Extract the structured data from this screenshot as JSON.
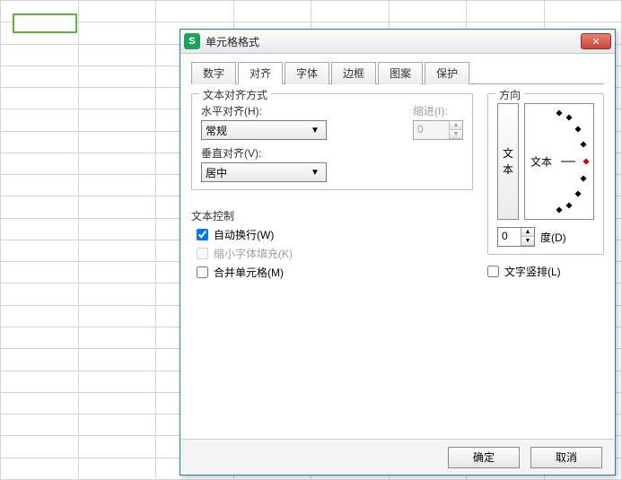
{
  "dialog": {
    "title": "单元格格式",
    "close": "✕",
    "tabs": [
      "数字",
      "对齐",
      "字体",
      "边框",
      "图案",
      "保护"
    ],
    "active_tab": 1,
    "ok": "确定",
    "cancel": "取消"
  },
  "align": {
    "group_label": "文本对齐方式",
    "h_label": "水平对齐(H):",
    "h_value": "常规",
    "indent_label": "缩进(I):",
    "indent_value": "0",
    "v_label": "垂直对齐(V):",
    "v_value": "居中"
  },
  "text_control": {
    "group_label": "文本控制",
    "wrap": "自动换行(W)",
    "wrap_checked": true,
    "shrink": "缩小字体填充(K)",
    "shrink_checked": false,
    "merge": "合并单元格(M)",
    "merge_checked": false
  },
  "orientation": {
    "group_label": "方向",
    "vert_text": "文本",
    "dial_label": "文本",
    "degree_value": "0",
    "degree_label": "度(D)",
    "vertical_check": "文字竖排(L)",
    "vertical_checked": false
  }
}
